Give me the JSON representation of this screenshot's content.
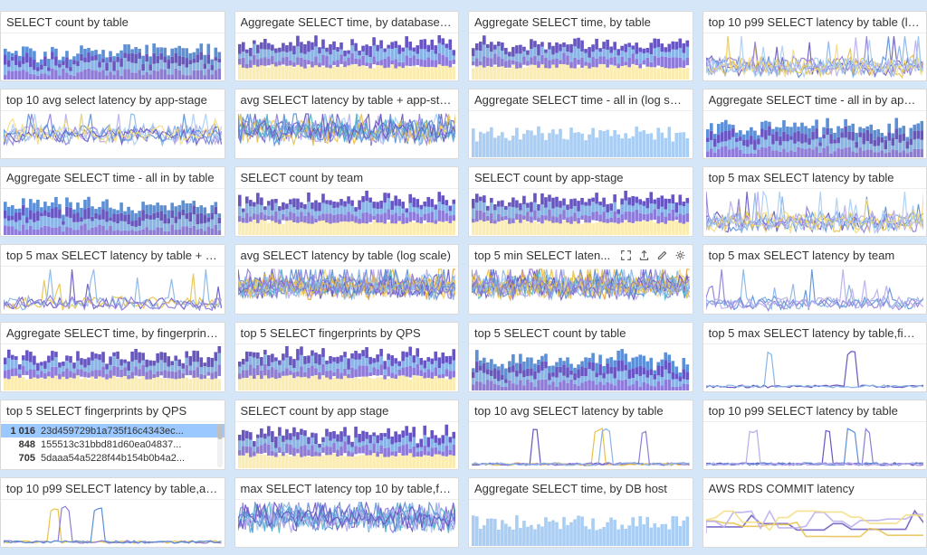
{
  "colors": {
    "blue1": "#5b8fd6",
    "blue2": "#88b4e6",
    "blue3": "#a9cdf3",
    "purple1": "#6755c1",
    "purple2": "#8e7bd8",
    "purple3": "#b8aceb",
    "yellow1": "#e8c14a",
    "yellow2": "#f5dc7a",
    "yellow3": "#fbecb1",
    "teal": "#4db3c9",
    "orange": "#e6a23c"
  },
  "hovered_panel_index": 14,
  "hover_actions": [
    "fullscreen",
    "share",
    "edit",
    "settings"
  ],
  "panels": [
    {
      "title": "SELECT count by table",
      "type": "stacked-bars"
    },
    {
      "title": "Aggregate SELECT time, by database_h...",
      "type": "stacked-bars-y"
    },
    {
      "title": "Aggregate SELECT time, by table",
      "type": "stacked-bars-y"
    },
    {
      "title": "top 10 p99 SELECT latency by table (log ...",
      "type": "lines-spiky"
    },
    {
      "title": "top 10 avg select latency by app-stage",
      "type": "lines-wavy"
    },
    {
      "title": "avg SELECT latency by table + app-stage",
      "type": "lines-messy"
    },
    {
      "title": "Aggregate SELECT time - all in (log scale)",
      "type": "bars-uniform"
    },
    {
      "title": "Aggregate SELECT time - all in by app-s...",
      "type": "stacked-bars"
    },
    {
      "title": "Aggregate SELECT time - all in by table",
      "type": "stacked-bars"
    },
    {
      "title": "SELECT count by team",
      "type": "stacked-bars-y"
    },
    {
      "title": "SELECT count by app-stage",
      "type": "stacked-bars-y"
    },
    {
      "title": "top 5 max SELECT latency by table",
      "type": "lines-spiky"
    },
    {
      "title": "top 5 max SELECT latency by table + ap...",
      "type": "lines-sparse"
    },
    {
      "title": "avg SELECT latency by table (log scale)",
      "type": "lines-dense"
    },
    {
      "title": "top 5 min SELECT laten...",
      "type": "lines-dense",
      "hovered": true
    },
    {
      "title": "top 5 max SELECT latency by team",
      "type": "lines-sparse-b"
    },
    {
      "title": "Aggregate SELECT time, by fingerprint/...",
      "type": "stacked-bars-y"
    },
    {
      "title": "top 5 SELECT fingerprints by QPS",
      "type": "stacked-bars-y"
    },
    {
      "title": "top 5 SELECT count by table",
      "type": "stacked-bars"
    },
    {
      "title": "top 5 max SELECT latency by table,finge...",
      "type": "lines-one-spike"
    },
    {
      "title": "top 5 SELECT fingerprints by QPS",
      "type": "list",
      "rows": [
        {
          "value": "1 016",
          "key": "23d459729b1a735f16c4343ec...",
          "selected": true
        },
        {
          "value": "848",
          "key": "155513c31bbd81d60ea04837...",
          "selected": false
        },
        {
          "value": "705",
          "key": "5daaa54a5228f44b154b0b4a2...",
          "selected": false
        }
      ]
    },
    {
      "title": "SELECT count by app stage",
      "type": "stacked-bars-y"
    },
    {
      "title": "top 10 avg SELECT latency by table",
      "type": "lines-sparse-p"
    },
    {
      "title": "top 10 p99 SELECT latency by table",
      "type": "lines-sparse-p2"
    },
    {
      "title": "top 10 p99 SELECT latency by table,app-...",
      "type": "lines-two-spikes"
    },
    {
      "title": "max SELECT latency top 10 by table,fing...",
      "type": "lines-noisy"
    },
    {
      "title": "Aggregate SELECT time, by DB host",
      "type": "bars-uniform"
    },
    {
      "title": "AWS RDS COMMIT latency",
      "type": "lines-step"
    }
  ],
  "chart_data": [
    {
      "type": "bar",
      "note": "stacked dense bars",
      "series_count": 5,
      "bars": 60
    },
    {
      "type": "bar",
      "note": "stacked purple/yellow",
      "series_count": 4,
      "bars": 60
    },
    {
      "type": "bar",
      "note": "stacked purple/yellow/blue",
      "series_count": 5,
      "bars": 60
    },
    {
      "type": "line",
      "note": "many overlapping log lines",
      "series_count": 10
    },
    {
      "type": "line",
      "series_count": 8
    },
    {
      "type": "line",
      "series_count": 12
    },
    {
      "type": "bar",
      "series_count": 1,
      "bars": 60
    },
    {
      "type": "bar",
      "series_count": 5,
      "bars": 60
    },
    {
      "type": "bar",
      "series_count": 5,
      "bars": 60
    },
    {
      "type": "bar",
      "series_count": 6,
      "bars": 60
    },
    {
      "type": "bar",
      "series_count": 6,
      "bars": 60
    },
    {
      "type": "line",
      "series_count": 5
    },
    {
      "type": "line",
      "series_count": 5
    },
    {
      "type": "line",
      "series_count": 15
    },
    {
      "type": "line",
      "series_count": 15
    },
    {
      "type": "line",
      "series_count": 5
    },
    {
      "type": "bar",
      "series_count": 6,
      "bars": 60
    },
    {
      "type": "bar",
      "series_count": 5,
      "bars": 60
    },
    {
      "type": "bar",
      "series_count": 5,
      "bars": 60
    },
    {
      "type": "line",
      "series_count": 5
    },
    {
      "type": "table",
      "rows": 3
    },
    {
      "type": "bar",
      "series_count": 6,
      "bars": 60
    },
    {
      "type": "line",
      "series_count": 10
    },
    {
      "type": "line",
      "series_count": 10
    },
    {
      "type": "line",
      "series_count": 10
    },
    {
      "type": "line",
      "series_count": 10
    },
    {
      "type": "bar",
      "series_count": 1,
      "bars": 60
    },
    {
      "type": "line",
      "series_count": 4
    }
  ]
}
